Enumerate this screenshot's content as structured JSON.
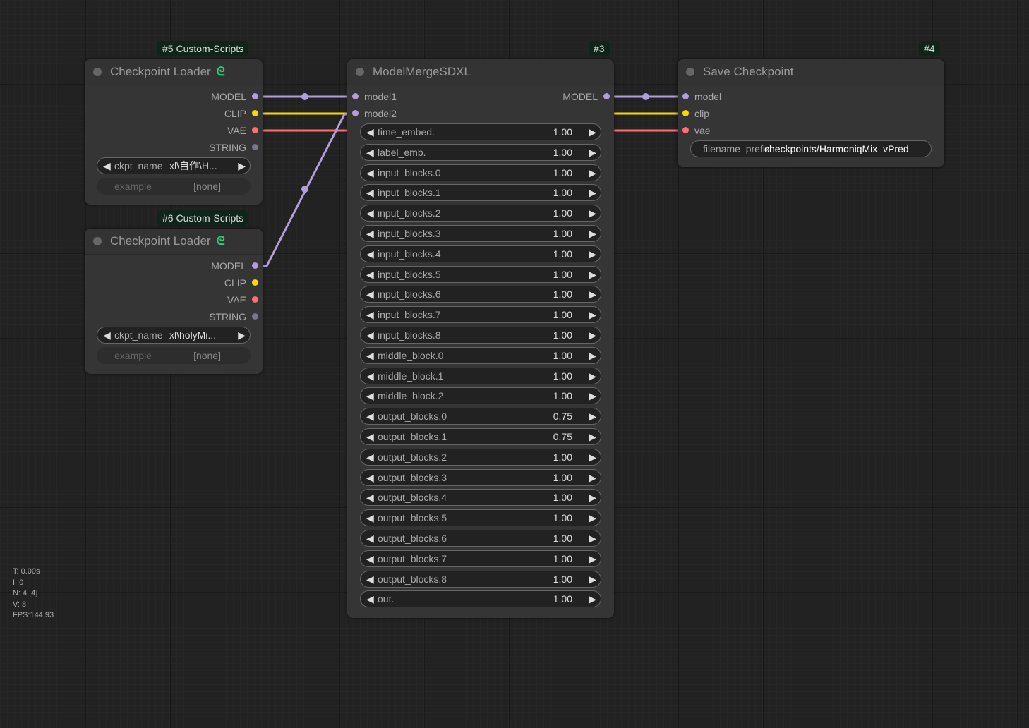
{
  "nodes": {
    "loader1": {
      "badge": "#5 Custom-Scripts",
      "title": "Checkpoint Loader",
      "outputs": [
        "MODEL",
        "CLIP",
        "VAE",
        "STRING"
      ],
      "ckpt_label": "ckpt_name",
      "ckpt_value": "xl\\自作\\H...",
      "example_label": "example",
      "example_value": "[none]"
    },
    "loader2": {
      "badge": "#6 Custom-Scripts",
      "title": "Checkpoint Loader",
      "outputs": [
        "MODEL",
        "CLIP",
        "VAE",
        "STRING"
      ],
      "ckpt_label": "ckpt_name",
      "ckpt_value": "xl\\holyMi...",
      "example_label": "example",
      "example_value": "[none]"
    },
    "merge": {
      "badge": "#3",
      "title": "ModelMergeSDXL",
      "inputs": [
        "model1",
        "model2"
      ],
      "output": "MODEL",
      "widgets": [
        {
          "name": "time_embed.",
          "value": "1.00"
        },
        {
          "name": "label_emb.",
          "value": "1.00"
        },
        {
          "name": "input_blocks.0",
          "value": "1.00"
        },
        {
          "name": "input_blocks.1",
          "value": "1.00"
        },
        {
          "name": "input_blocks.2",
          "value": "1.00"
        },
        {
          "name": "input_blocks.3",
          "value": "1.00"
        },
        {
          "name": "input_blocks.4",
          "value": "1.00"
        },
        {
          "name": "input_blocks.5",
          "value": "1.00"
        },
        {
          "name": "input_blocks.6",
          "value": "1.00"
        },
        {
          "name": "input_blocks.7",
          "value": "1.00"
        },
        {
          "name": "input_blocks.8",
          "value": "1.00"
        },
        {
          "name": "middle_block.0",
          "value": "1.00"
        },
        {
          "name": "middle_block.1",
          "value": "1.00"
        },
        {
          "name": "middle_block.2",
          "value": "1.00"
        },
        {
          "name": "output_blocks.0",
          "value": "0.75"
        },
        {
          "name": "output_blocks.1",
          "value": "0.75"
        },
        {
          "name": "output_blocks.2",
          "value": "1.00"
        },
        {
          "name": "output_blocks.3",
          "value": "1.00"
        },
        {
          "name": "output_blocks.4",
          "value": "1.00"
        },
        {
          "name": "output_blocks.5",
          "value": "1.00"
        },
        {
          "name": "output_blocks.6",
          "value": "1.00"
        },
        {
          "name": "output_blocks.7",
          "value": "1.00"
        },
        {
          "name": "output_blocks.8",
          "value": "1.00"
        },
        {
          "name": "out.",
          "value": "1.00"
        }
      ]
    },
    "save": {
      "badge": "#4",
      "title": "Save Checkpoint",
      "inputs": [
        "model",
        "clip",
        "vae"
      ],
      "prefix_label": "filename_prefix",
      "prefix_value": "checkpoints/HarmoniqMix_vPred_"
    }
  },
  "stats": [
    "T: 0.00s",
    "I: 0",
    "N: 4 [4]",
    "V: 8",
    "FPS:144.93"
  ],
  "colors": {
    "model": "#b39ddb",
    "clip": "#ffd500",
    "vae": "#ff6e6e",
    "string": "#777788"
  },
  "icons": {
    "snake": "custom-scripts-snake-icon",
    "left": "◀",
    "right": "▶"
  }
}
